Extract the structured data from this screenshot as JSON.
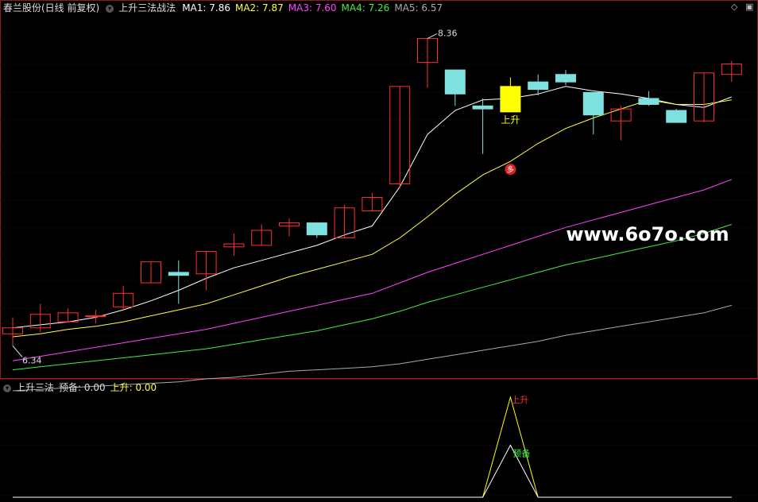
{
  "header": {
    "stock": "春兰股份(日线 前复权)",
    "indicator": "上升三法战法",
    "ma": [
      {
        "label": "MA1: 7.86",
        "color": "#ffffff"
      },
      {
        "label": "MA2: 7.87",
        "color": "#ffff44"
      },
      {
        "label": "MA3: 7.60",
        "color": "#ff44ff"
      },
      {
        "label": "MA4: 7.26",
        "color": "#44ee44"
      },
      {
        "label": "MA5: 6.57",
        "color": "#aaaaaa"
      }
    ]
  },
  "sub_header": {
    "title": "上升三法",
    "prep_label": "预备: 0.00",
    "rise_label": "上升: 0.00"
  },
  "annotations": {
    "high": "8.36",
    "low": "6.34",
    "rise_main": "上升",
    "badge": "多",
    "sub_rise": "上升",
    "sub_prep": "预备"
  },
  "watermark": "www.6o7o.com",
  "colors": {
    "up": "#ff3030",
    "down": "#7fe0e0",
    "signal": "#ffff00"
  },
  "chart_data": {
    "type": "candlestick",
    "price_range": [
      6.1,
      8.5
    ],
    "candles": [
      [
        6.39,
        6.43,
        6.5,
        6.31
      ],
      [
        6.43,
        6.52,
        6.59,
        6.4
      ],
      [
        6.47,
        6.53,
        6.56,
        6.47
      ],
      [
        6.51,
        6.51,
        6.55,
        6.46
      ],
      [
        6.57,
        6.66,
        6.71,
        6.55
      ],
      [
        6.73,
        6.87,
        6.87,
        6.73
      ],
      [
        6.8,
        6.78,
        6.88,
        6.59
      ],
      [
        6.79,
        6.94,
        6.94,
        6.68
      ],
      [
        6.97,
        6.99,
        7.06,
        6.91
      ],
      [
        6.98,
        7.08,
        7.12,
        6.98
      ],
      [
        7.11,
        7.13,
        7.16,
        7.04
      ],
      [
        7.13,
        7.05,
        7.13,
        7.03
      ],
      [
        7.03,
        7.23,
        7.25,
        7.03
      ],
      [
        7.21,
        7.3,
        7.33,
        7.21
      ],
      [
        7.39,
        8.04,
        8.04,
        7.36
      ],
      [
        8.2,
        8.36,
        8.36,
        8.03
      ],
      [
        8.15,
        7.99,
        8.15,
        7.91
      ],
      [
        7.91,
        7.89,
        7.96,
        7.59
      ],
      [
        7.87,
        8.04,
        8.1,
        7.89
      ],
      [
        8.07,
        8.02,
        8.12,
        7.98
      ],
      [
        8.12,
        8.07,
        8.15,
        8.05
      ],
      [
        8.0,
        7.85,
        8.0,
        7.72
      ],
      [
        7.81,
        7.89,
        7.91,
        7.68
      ],
      [
        7.96,
        7.92,
        8.01,
        7.91
      ],
      [
        7.88,
        7.8,
        7.89,
        7.8
      ],
      [
        7.81,
        8.13,
        8.13,
        7.8
      ],
      [
        8.12,
        8.19,
        8.21,
        8.07
      ]
    ],
    "signal_candle": 18,
    "ma_lines": [
      {
        "name": "MA1",
        "color": "#ffffff",
        "values": [
          6.43,
          6.45,
          6.47,
          6.5,
          6.55,
          6.61,
          6.68,
          6.76,
          6.83,
          6.88,
          6.93,
          6.98,
          7.05,
          7.11,
          7.37,
          7.72,
          7.88,
          7.95,
          7.96,
          7.99,
          8.04,
          8.01,
          7.99,
          7.96,
          7.92,
          7.9,
          7.97
        ]
      },
      {
        "name": "MA2",
        "color": "#ffff44",
        "values": [
          6.37,
          6.39,
          6.42,
          6.44,
          6.47,
          6.51,
          6.55,
          6.59,
          6.65,
          6.71,
          6.77,
          6.82,
          6.87,
          6.92,
          7.03,
          7.17,
          7.32,
          7.45,
          7.54,
          7.66,
          7.76,
          7.83,
          7.89,
          7.95,
          7.92,
          7.92,
          7.95
        ]
      },
      {
        "name": "MA3",
        "color": "#ff44ff",
        "values": [
          6.21,
          6.24,
          6.27,
          6.3,
          6.33,
          6.36,
          6.39,
          6.42,
          6.46,
          6.5,
          6.54,
          6.58,
          6.62,
          6.66,
          6.73,
          6.8,
          6.86,
          6.92,
          6.98,
          7.04,
          7.1,
          7.15,
          7.2,
          7.25,
          7.3,
          7.35,
          7.42
        ]
      },
      {
        "name": "MA4",
        "color": "#44ee44",
        "values": [
          6.15,
          6.17,
          6.19,
          6.21,
          6.23,
          6.25,
          6.27,
          6.29,
          6.32,
          6.35,
          6.38,
          6.41,
          6.45,
          6.49,
          6.54,
          6.6,
          6.65,
          6.7,
          6.75,
          6.8,
          6.85,
          6.89,
          6.93,
          6.97,
          7.01,
          7.06,
          7.12
        ]
      },
      {
        "name": "MA5",
        "color": "#aaaaaa",
        "values": [
          6.01,
          6.02,
          6.03,
          6.04,
          6.05,
          6.06,
          6.07,
          6.09,
          6.1,
          6.12,
          6.14,
          6.15,
          6.16,
          6.17,
          6.19,
          6.22,
          6.25,
          6.28,
          6.31,
          6.34,
          6.38,
          6.41,
          6.44,
          6.47,
          6.5,
          6.53,
          6.58
        ]
      }
    ],
    "sub": {
      "range": [
        0,
        1
      ],
      "rise": [
        0,
        0,
        0,
        0,
        0,
        0,
        0,
        0,
        0,
        0,
        0,
        0,
        0,
        0,
        0,
        0,
        0,
        0,
        1,
        0,
        0,
        0,
        0,
        0,
        0,
        0,
        0
      ],
      "prep": [
        0,
        0,
        0,
        0,
        0,
        0,
        0,
        0,
        0,
        0,
        0,
        0,
        0,
        0,
        0,
        0,
        0,
        0,
        0.52,
        0,
        0,
        0,
        0,
        0,
        0,
        0,
        0
      ]
    }
  }
}
